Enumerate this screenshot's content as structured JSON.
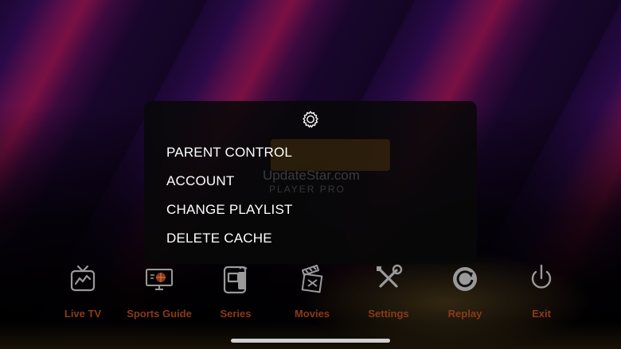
{
  "menu": {
    "icon": "gear-icon",
    "items": [
      {
        "label": "PARENT CONTROL"
      },
      {
        "label": "ACCOUNT"
      },
      {
        "label": "CHANGE PLAYLIST"
      },
      {
        "label": "DELETE CACHE"
      }
    ],
    "background_logo": {
      "text": "UpdateStar.com",
      "sub": "PLAYER PRO"
    }
  },
  "dock": {
    "items": [
      {
        "label": "Live TV",
        "icon": "tv-icon"
      },
      {
        "label": "Sports Guide",
        "icon": "sports-guide-icon"
      },
      {
        "label": "Series",
        "icon": "series-icon"
      },
      {
        "label": "Movies",
        "icon": "movies-icon"
      },
      {
        "label": "Settings",
        "icon": "settings-tools-icon"
      },
      {
        "label": "Replay",
        "icon": "replay-icon"
      },
      {
        "label": "Exit",
        "icon": "power-icon"
      }
    ]
  },
  "colors": {
    "background_dark": "#140524",
    "background_stripe": "#7a1044",
    "label_color": "#8a3a1c",
    "menu_text": "#ffffff",
    "icon_color": "#9a9a9a"
  }
}
